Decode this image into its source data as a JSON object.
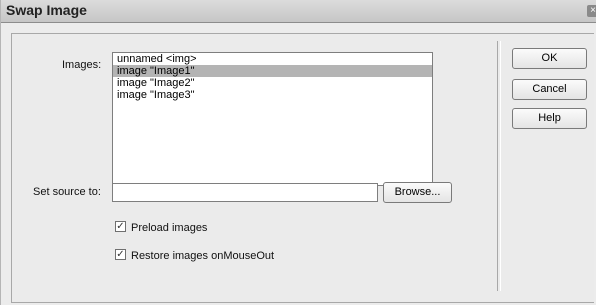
{
  "window": {
    "title": "Swap Image",
    "close_glyph": "×"
  },
  "images": {
    "label": "Images:",
    "items": [
      {
        "label": "unnamed <img>",
        "selected": false
      },
      {
        "label": "image \"Image1\"",
        "selected": true
      },
      {
        "label": "image \"Image2\"",
        "selected": false
      },
      {
        "label": "image \"Image3\"",
        "selected": false
      }
    ]
  },
  "source": {
    "label": "Set source to:",
    "value": "",
    "browse_label": "Browse..."
  },
  "options": {
    "preload_label": "Preload images",
    "preload_checked": true,
    "restore_label": "Restore images onMouseOut",
    "restore_checked": true,
    "check_glyph": "✓"
  },
  "buttons": {
    "ok": "OK",
    "cancel": "Cancel",
    "help": "Help"
  }
}
